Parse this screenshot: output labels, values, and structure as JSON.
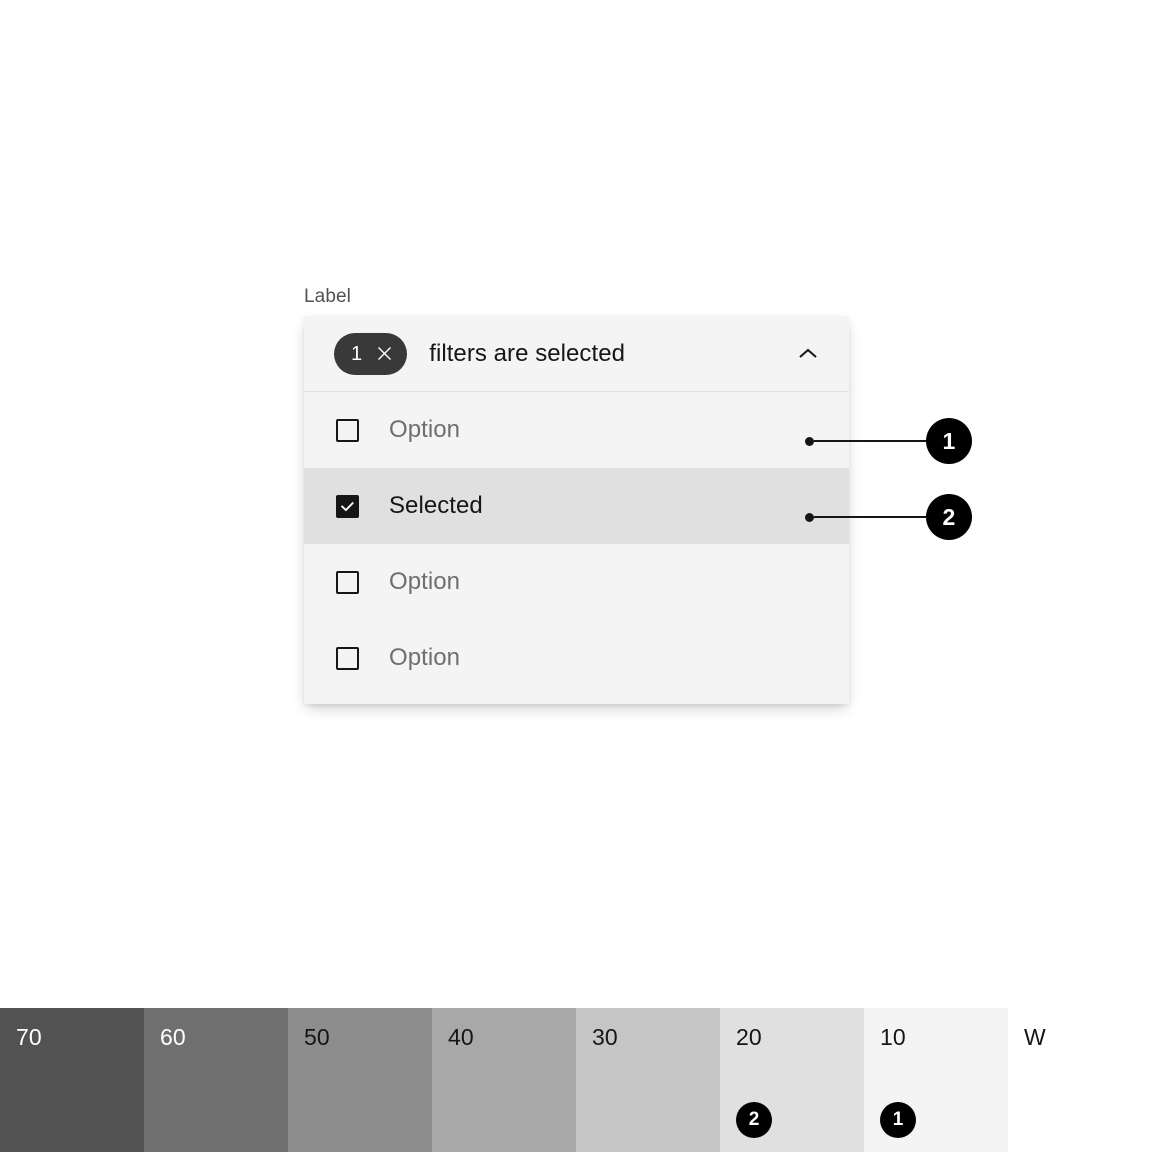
{
  "component": {
    "label": "Label",
    "field": {
      "tag_count": "1",
      "tag_close_icon": "close-icon",
      "text": "filters are selected",
      "chevron_icon": "chevron-up-icon"
    },
    "options": [
      {
        "label": "Option",
        "checked": false,
        "highlighted": false
      },
      {
        "label": "Selected",
        "checked": true,
        "highlighted": true
      },
      {
        "label": "Option",
        "checked": false,
        "highlighted": false
      },
      {
        "label": "Option",
        "checked": false,
        "highlighted": false
      }
    ]
  },
  "callouts": [
    {
      "number": "1"
    },
    {
      "number": "2"
    }
  ],
  "swatches": [
    {
      "label": "70",
      "color": "#525252",
      "text_color": "#ffffff",
      "badge": null
    },
    {
      "label": "60",
      "color": "#6f6f6f",
      "text_color": "#ffffff",
      "badge": null
    },
    {
      "label": "50",
      "color": "#8d8d8d",
      "text_color": "#161616",
      "badge": null
    },
    {
      "label": "40",
      "color": "#a8a8a8",
      "text_color": "#161616",
      "badge": null
    },
    {
      "label": "30",
      "color": "#c6c6c6",
      "text_color": "#161616",
      "badge": null
    },
    {
      "label": "20",
      "color": "#e0e0e0",
      "text_color": "#161616",
      "badge": "2"
    },
    {
      "label": "10",
      "color": "#f4f4f4",
      "text_color": "#161616",
      "badge": "1"
    },
    {
      "label": "W",
      "color": "#ffffff",
      "text_color": "#161616",
      "badge": null
    }
  ]
}
